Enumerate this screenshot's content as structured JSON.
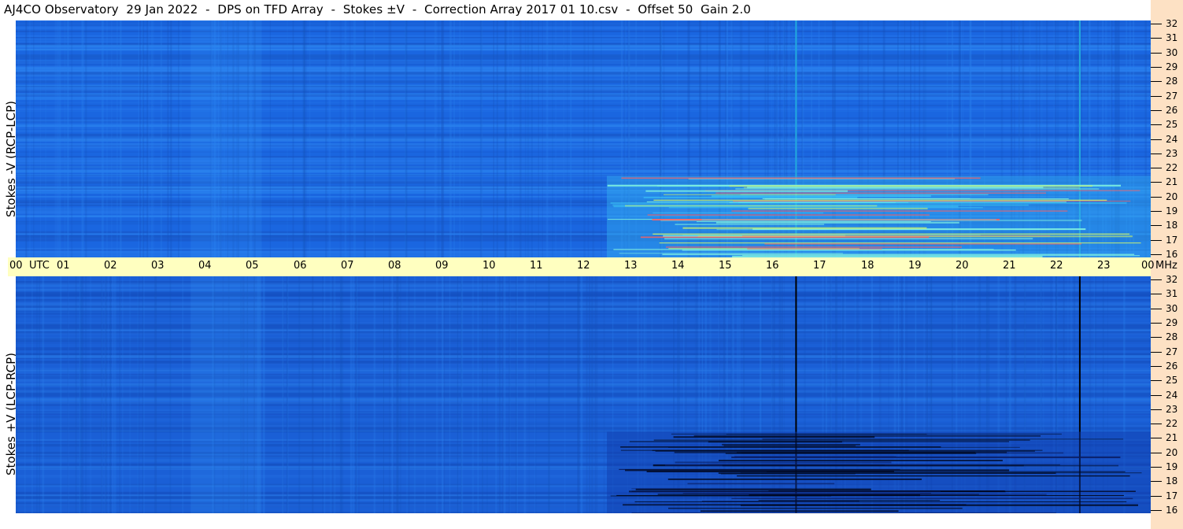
{
  "title": "AJ4CO Observatory  29 Jan 2022  -  DPS on TFD Array  -  Stokes ±V  -  Correction Array 2017 01 10.csv  -  Offset 50  Gain 2.0",
  "ylabel_top": "Stokes -V (RCP-LCP)",
  "ylabel_bottom": "Stokes +V (LCP-RCP)",
  "time_axis": {
    "labels": [
      "00",
      "UTC",
      "01",
      "02",
      "03",
      "04",
      "05",
      "06",
      "07",
      "08",
      "09",
      "10",
      "11",
      "12",
      "13",
      "14",
      "15",
      "16",
      "17",
      "18",
      "19",
      "20",
      "21",
      "22",
      "23",
      "00",
      "MHz"
    ]
  },
  "colors": {
    "bg_top": "#1a66e0",
    "bg_bottom": "#1a5fd6",
    "timebar": "#ffffc0",
    "freqbar": "#fde1c4"
  },
  "chart_data": [
    {
      "type": "heatmap",
      "title": "Stokes -V (RCP-LCP)",
      "x_unit": "UTC hour",
      "x_ticks": [
        0,
        1,
        2,
        3,
        4,
        5,
        6,
        7,
        8,
        9,
        10,
        11,
        12,
        13,
        14,
        15,
        16,
        17,
        18,
        19,
        20,
        21,
        22,
        23,
        24
      ],
      "y_unit": "MHz",
      "y_ticks": [
        16,
        17,
        18,
        19,
        20,
        21,
        22,
        23,
        24,
        25,
        26,
        27,
        28,
        29,
        30,
        31,
        32
      ],
      "ylim": [
        16,
        32
      ],
      "xlim": [
        0,
        24
      ],
      "features": [
        {
          "kind": "vertical_line",
          "x": 16.5,
          "color": "#22aadd"
        },
        {
          "kind": "vertical_line",
          "x": 22.5,
          "color": "#22aadd"
        },
        {
          "kind": "enhanced_region",
          "x": [
            12.5,
            24
          ],
          "y": [
            16,
            21.5
          ]
        }
      ]
    },
    {
      "type": "heatmap",
      "title": "Stokes +V (LCP-RCP)",
      "x_unit": "UTC hour",
      "x_ticks": [
        0,
        1,
        2,
        3,
        4,
        5,
        6,
        7,
        8,
        9,
        10,
        11,
        12,
        13,
        14,
        15,
        16,
        17,
        18,
        19,
        20,
        21,
        22,
        23,
        24
      ],
      "y_unit": "MHz",
      "y_ticks": [
        16,
        17,
        18,
        19,
        20,
        21,
        22,
        23,
        24,
        25,
        26,
        27,
        28,
        29,
        30,
        31,
        32
      ],
      "ylim": [
        16,
        32
      ],
      "xlim": [
        0,
        24
      ],
      "features": [
        {
          "kind": "vertical_line",
          "x": 16.5,
          "color": "#000000"
        },
        {
          "kind": "vertical_line",
          "x": 22.5,
          "color": "#000000"
        },
        {
          "kind": "dark_region",
          "x": [
            12.5,
            24
          ],
          "y": [
            16,
            21.5
          ]
        }
      ]
    }
  ],
  "freq_labels": [
    "32",
    "31",
    "30",
    "29",
    "28",
    "27",
    "26",
    "25",
    "24",
    "23",
    "22",
    "21",
    "20",
    "19",
    "18",
    "17",
    "16"
  ]
}
